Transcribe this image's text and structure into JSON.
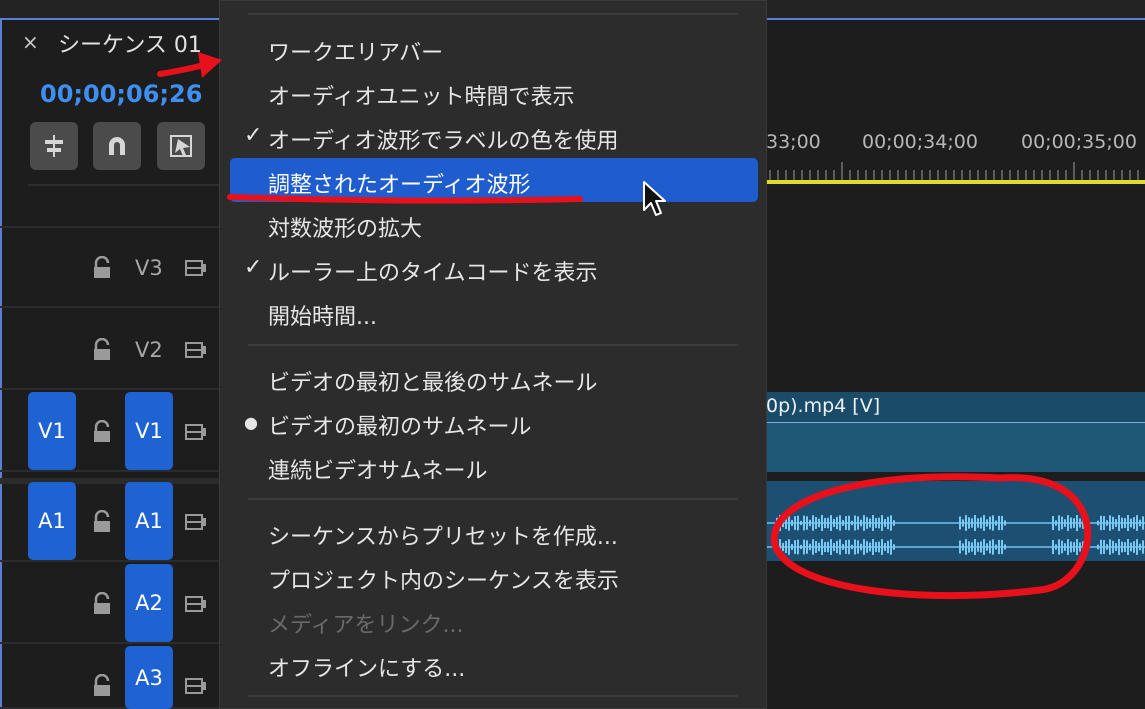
{
  "panel": {
    "tab_close": "×",
    "tab_title": "シーケンス 01",
    "timecode": "00;00;06;26"
  },
  "ruler": {
    "labels": [
      "33;00",
      "00;00;34;00",
      "00;00;35;00"
    ]
  },
  "tracks": {
    "v3": "V3",
    "v2": "V2",
    "v1_src": "V1",
    "v1": "V1",
    "a1_src": "A1",
    "a1": "A1",
    "a2": "A2",
    "a3": "A3"
  },
  "clip": {
    "video_name": "0p).mp4 [V]"
  },
  "menu": {
    "items": [
      {
        "label": "ワークエリアバー",
        "mark": ""
      },
      {
        "label": "オーディオユニット時間で表示",
        "mark": ""
      },
      {
        "label": "オーディオ波形でラベルの色を使用",
        "mark": "✓"
      },
      {
        "label": "調整されたオーディオ波形",
        "mark": ""
      },
      {
        "label": "対数波形の拡大",
        "mark": ""
      },
      {
        "label": "ルーラー上のタイムコードを表示",
        "mark": "✓"
      },
      {
        "label": "開始時間...",
        "mark": ""
      },
      {
        "label": "ビデオの最初と最後のサムネール",
        "mark": ""
      },
      {
        "label": "ビデオの最初のサムネール",
        "mark": "●"
      },
      {
        "label": "連続ビデオサムネール",
        "mark": ""
      },
      {
        "label": "シーケンスからプリセットを作成...",
        "mark": ""
      },
      {
        "label": "プロジェクト内のシーケンスを表示",
        "mark": ""
      },
      {
        "label": "メディアをリンク...",
        "mark": ""
      },
      {
        "label": "オフラインにする...",
        "mark": ""
      }
    ]
  },
  "colors": {
    "accent": "#1f5ccd",
    "timecode": "#3f8ff0",
    "annotation": "#e8101a",
    "work_area": "#e3da2c"
  }
}
